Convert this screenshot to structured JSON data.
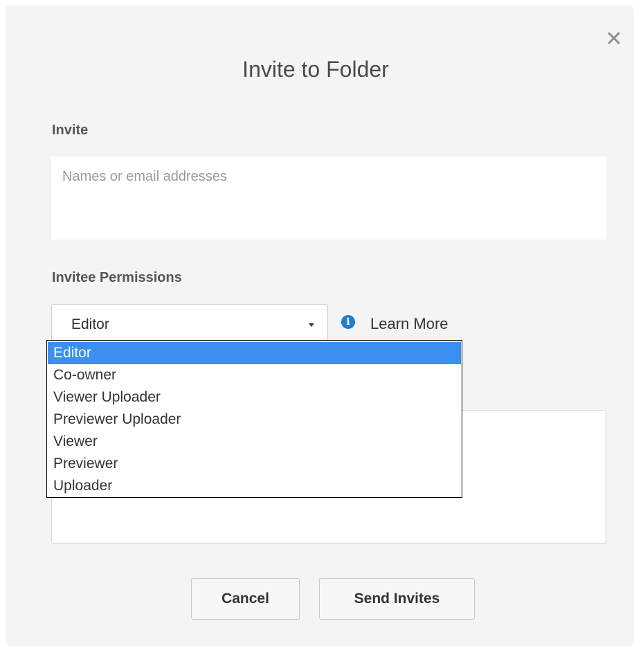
{
  "dialog": {
    "title": "Invite to Folder",
    "close_glyph": "✕"
  },
  "invite": {
    "label": "Invite",
    "placeholder": "Names or email addresses",
    "value": ""
  },
  "permissions": {
    "label": "Invitee Permissions",
    "selected": "Editor",
    "learn_more": "Learn More",
    "info_glyph": "i",
    "options": [
      "Editor",
      "Co-owner",
      "Viewer Uploader",
      "Previewer Uploader",
      "Viewer",
      "Previewer",
      "Uploader"
    ]
  },
  "buttons": {
    "cancel": "Cancel",
    "send": "Send Invites"
  },
  "colors": {
    "accent": "#3a8ff0",
    "info": "#1e7ecb"
  }
}
